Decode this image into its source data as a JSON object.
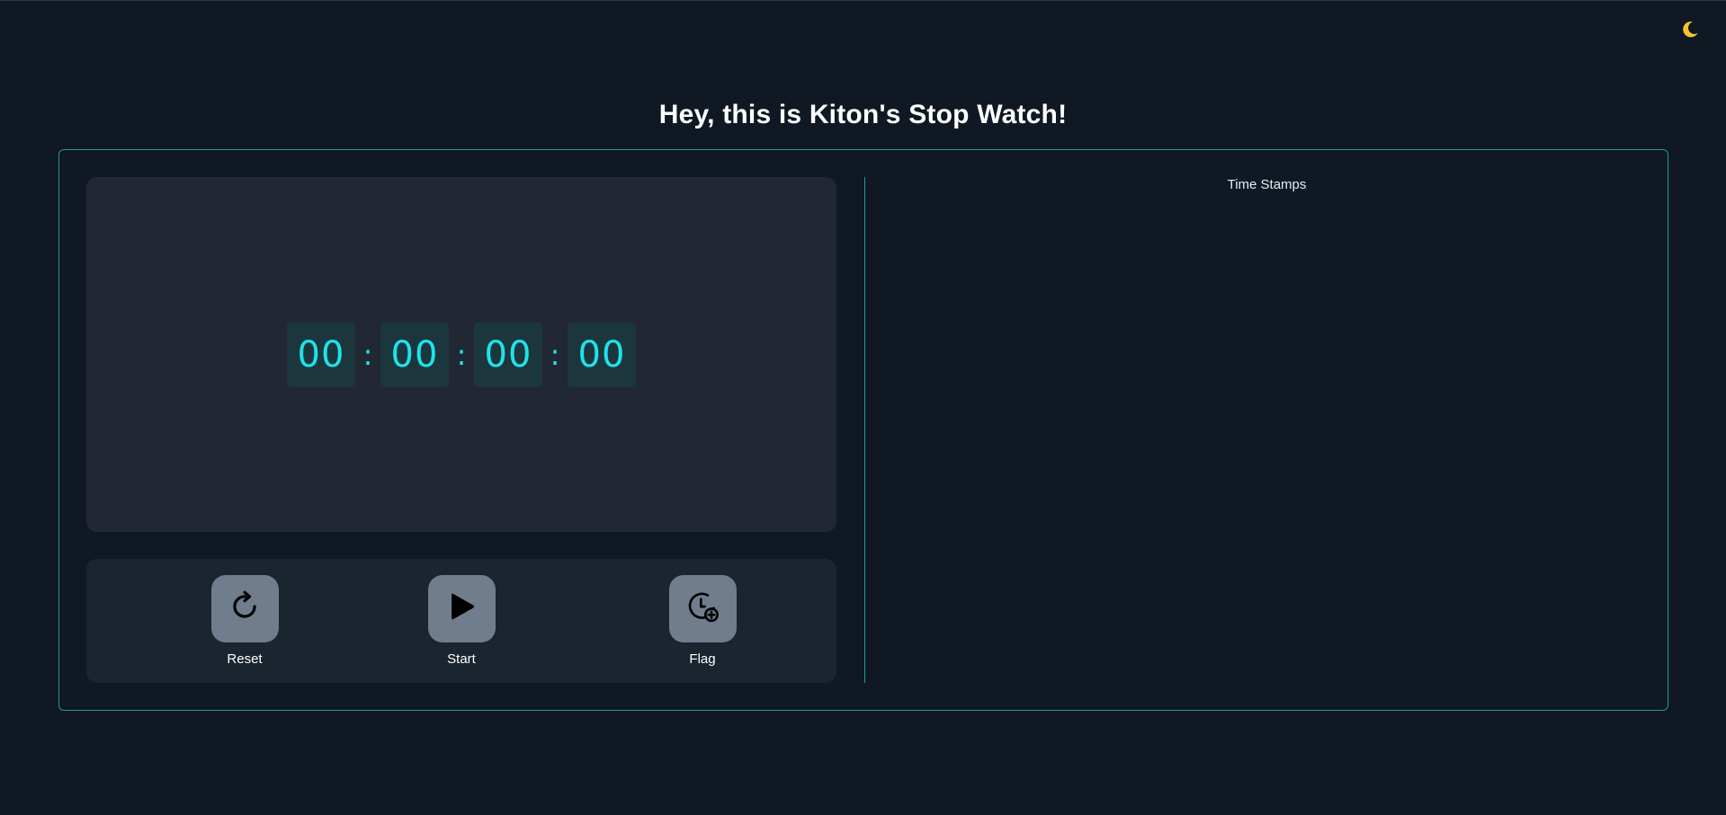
{
  "header": {
    "title": "Hey, this is Kiton's Stop Watch!",
    "theme_icon": "moon-icon"
  },
  "timer": {
    "hours": "00",
    "minutes": "00",
    "seconds": "00",
    "centiseconds": "00",
    "separator": ":"
  },
  "controls": {
    "reset": {
      "label": "Reset",
      "icon": "reset-icon"
    },
    "start": {
      "label": "Start",
      "icon": "play-icon"
    },
    "flag": {
      "label": "Flag",
      "icon": "flag-clock-icon"
    }
  },
  "timestamps": {
    "title": "Time Stamps",
    "items": []
  },
  "colors": {
    "background": "#0f1823",
    "accent": "#1ee3ea",
    "border": "#1f9a9c",
    "panel": "#212833",
    "button": "#707d8c",
    "moon": "#f4c430"
  }
}
